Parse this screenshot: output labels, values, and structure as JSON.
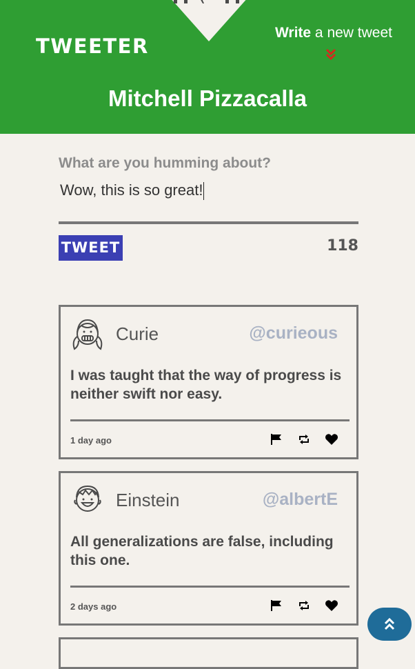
{
  "header": {
    "brand": "TWEETER",
    "write_bold": "Write",
    "write_rest": " a new tweet",
    "profile_name": "Mitchell Pizzacalla",
    "accent_color": "#2f9e33"
  },
  "composer": {
    "label": "What are you humming about?",
    "text": "Wow, this is so great!",
    "submit_label": "TWEET",
    "char_count": "118"
  },
  "tweets": [
    {
      "name": "Curie",
      "handle": "@curieous",
      "body": "I was taught that the way of progress is neither swift nor easy.",
      "time": "1 day ago",
      "avatar_icon": "girl-avatar-icon"
    },
    {
      "name": "Einstein",
      "handle": "@albertE",
      "body": "All generalizations are false, including this one.",
      "time": "2 days ago",
      "avatar_icon": "boy-avatar-icon"
    }
  ],
  "icons": {
    "flag": "flag-icon",
    "retweet": "retweet-icon",
    "like": "heart-icon",
    "scroll_top": "double-chevron-up-icon"
  }
}
